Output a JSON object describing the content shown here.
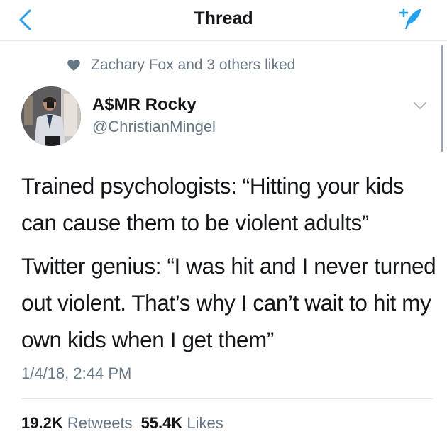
{
  "nav": {
    "title": "Thread",
    "back_icon": "chevron-left-icon",
    "compose_icon": "compose-tweet-icon",
    "accent_color": "#1da1f2"
  },
  "social_context": {
    "icon": "heart-icon",
    "text": "Zachary Fox and 3 others liked"
  },
  "tweet": {
    "author": {
      "display_name": "A$MR Rocky",
      "handle": "@ChristianMingel"
    },
    "text_paragraphs": [
      "Trained psychologists: “Hitting your kids can cause them to be violent adults”",
      "Twitter genius: “I was hit and I never turned out violent. That’s why I can’t wait to hit my own kids when I get them”"
    ],
    "timestamp": "1/4/18, 2:44 PM",
    "stats": {
      "retweets_count": "19.2K",
      "retweets_label": "Retweets",
      "likes_count": "55.4K",
      "likes_label": "Likes"
    }
  },
  "colors": {
    "text_primary": "#14171a",
    "text_secondary": "#657786",
    "divider": "#e1e8ed"
  }
}
